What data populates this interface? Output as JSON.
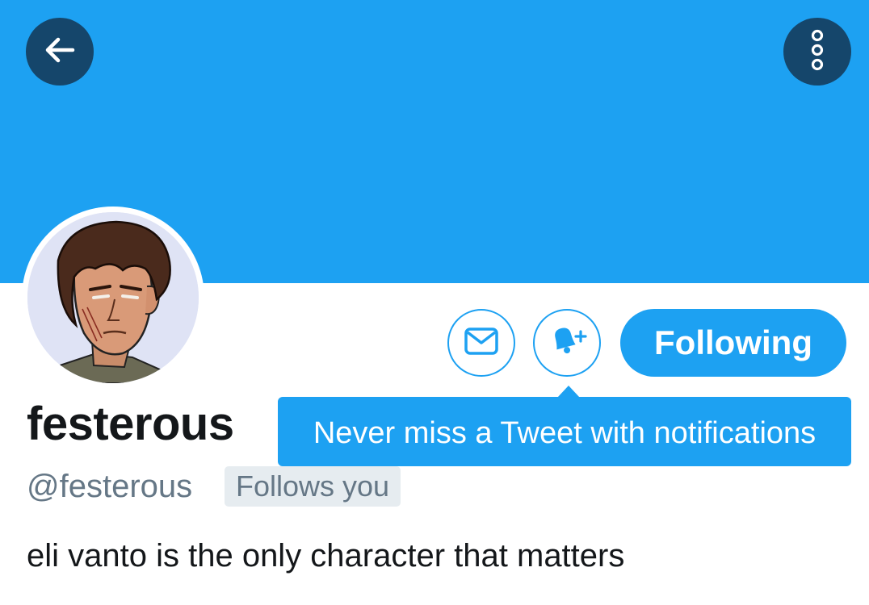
{
  "header": {
    "back_icon": "arrow-left-icon",
    "more_icon": "more-vertical-icon"
  },
  "profile": {
    "display_name": "festerous",
    "handle": "@festerous",
    "follows_you_badge": "Follows you",
    "bio": "eli vanto is the only character that matters",
    "avatar_icon": "avatar-illustration"
  },
  "actions": {
    "message_icon": "envelope-icon",
    "notify_icon": "bell-plus-icon",
    "following_label": "Following"
  },
  "tooltip": {
    "text": "Never miss a Tweet with notifications"
  },
  "colors": {
    "brand_blue": "#1da1f2",
    "header_button": "#15466b",
    "text_primary": "#14171a",
    "text_secondary": "#657786",
    "badge_bg": "#e6ecf0"
  }
}
